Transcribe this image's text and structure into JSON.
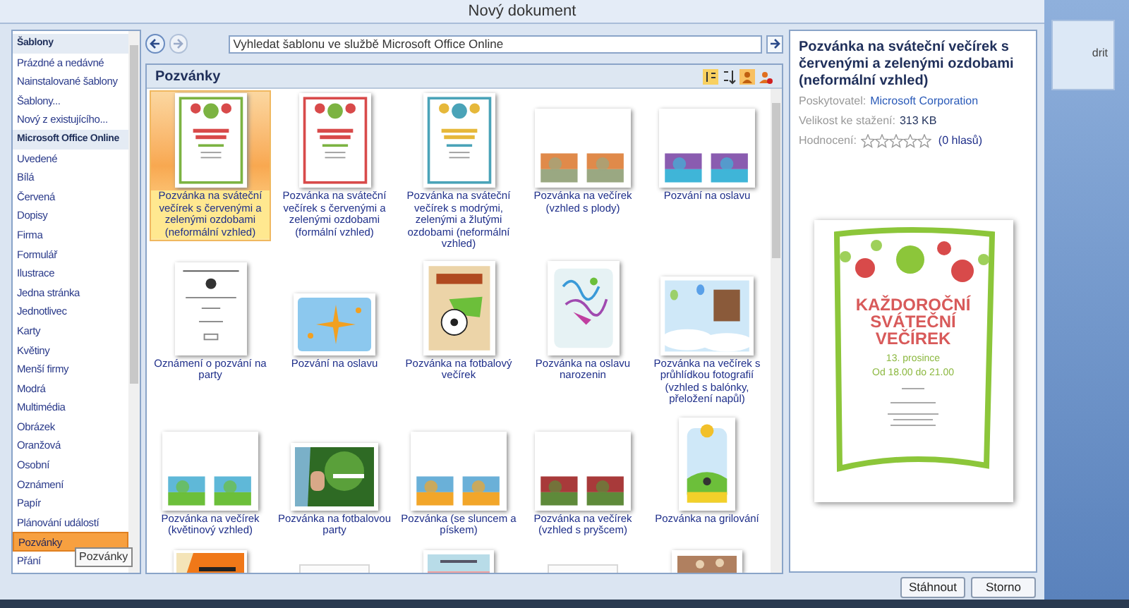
{
  "window": {
    "title": "Nový dokument"
  },
  "sidebar": {
    "items": [
      {
        "label": "Šablony",
        "kind": "header",
        "selected": false
      },
      {
        "label": "Prázdné a nedávné",
        "kind": "item",
        "selected": false
      },
      {
        "label": "Nainstalované šablony",
        "kind": "item",
        "selected": false
      },
      {
        "label": "Šablony...",
        "kind": "item",
        "selected": false
      },
      {
        "label": "Nový z existujícího...",
        "kind": "item",
        "selected": false
      },
      {
        "label": "Microsoft Office Online",
        "kind": "header",
        "selected": false
      },
      {
        "label": "Uvedené",
        "kind": "item",
        "selected": false
      },
      {
        "label": "Bílá",
        "kind": "item",
        "selected": false
      },
      {
        "label": "Červená",
        "kind": "item",
        "selected": false
      },
      {
        "label": "Dopisy",
        "kind": "item",
        "selected": false
      },
      {
        "label": "Firma",
        "kind": "item",
        "selected": false
      },
      {
        "label": "Formulář",
        "kind": "item",
        "selected": false
      },
      {
        "label": "Ilustrace",
        "kind": "item",
        "selected": false
      },
      {
        "label": "Jedna stránka",
        "kind": "item",
        "selected": false
      },
      {
        "label": "Jednotlivec",
        "kind": "item",
        "selected": false
      },
      {
        "label": "Karty",
        "kind": "item",
        "selected": false
      },
      {
        "label": "Květiny",
        "kind": "item",
        "selected": false
      },
      {
        "label": "Menší firmy",
        "kind": "item",
        "selected": false
      },
      {
        "label": "Modrá",
        "kind": "item",
        "selected": false
      },
      {
        "label": "Multimédia",
        "kind": "item",
        "selected": false
      },
      {
        "label": "Obrázek",
        "kind": "item",
        "selected": false
      },
      {
        "label": "Oranžová",
        "kind": "item",
        "selected": false
      },
      {
        "label": "Osobní",
        "kind": "item",
        "selected": false
      },
      {
        "label": "Oznámení",
        "kind": "item",
        "selected": false
      },
      {
        "label": "Papír",
        "kind": "item",
        "selected": false
      },
      {
        "label": "Plánování událostí",
        "kind": "item",
        "selected": false
      },
      {
        "label": "Pozvánky",
        "kind": "item",
        "selected": true
      },
      {
        "label": "Přání",
        "kind": "item",
        "selected": false
      }
    ],
    "tooltip": "Pozvánky"
  },
  "search": {
    "placeholder": "Vyhledat šablonu ve službě Microsoft Office Online"
  },
  "gallery": {
    "title": "Pozvánky",
    "templates": [
      {
        "label": "Pozvánka na sváteční večírek s červenými a zelenými ozdobami (neformální vzhled)",
        "kind": "ornament-green",
        "selected": true
      },
      {
        "label": "Pozvánka na sváteční večírek s červenými a zelenými ozdobami (formální vzhled)",
        "kind": "ornament-red",
        "selected": false
      },
      {
        "label": "Pozvánka na sváteční večírek s modrými, zelenými a žlutými ozdobami (neformální vzhled)",
        "kind": "ornament-blue",
        "selected": false
      },
      {
        "label": "Pozvánka na večírek (vzhled s plody)",
        "kind": "pair-orange",
        "selected": false
      },
      {
        "label": "Pozvání na oslavu",
        "kind": "pair-purple",
        "selected": false
      },
      {
        "label": "Oznámení o pozvání na party",
        "kind": "document",
        "selected": false
      },
      {
        "label": "Pozvání na oslavu",
        "kind": "stars",
        "selected": false
      },
      {
        "label": "Pozvánka na fotbalový večírek",
        "kind": "football",
        "selected": false
      },
      {
        "label": "Pozvánka na oslavu narozenin",
        "kind": "streamers",
        "selected": false
      },
      {
        "label": "Pozvánka na večírek s průhlídkou fotografií (vzhled s balónky, přeložení napůl)",
        "kind": "balloons",
        "selected": false
      },
      {
        "label": "Pozvánka na večírek (květinový vzhled)",
        "kind": "pair-grass",
        "selected": false
      },
      {
        "label": "Pozvánka na fotbalovou party",
        "kind": "green-card",
        "selected": false
      },
      {
        "label": "Pozvánka (se sluncem a pískem)",
        "kind": "pair-sun",
        "selected": false
      },
      {
        "label": "Pozvánka na večírek (vzhled s pryšcem)",
        "kind": "pair-flowers",
        "selected": false
      },
      {
        "label": "Pozvánka na grilování",
        "kind": "tall-sun",
        "selected": false
      },
      {
        "kind": "halloween",
        "selected": false
      },
      {
        "kind": "blank",
        "selected": false
      },
      {
        "kind": "card",
        "selected": false
      },
      {
        "kind": "blank",
        "selected": false
      },
      {
        "kind": "photo-brown",
        "selected": false
      }
    ]
  },
  "details": {
    "title": "Pozvánka na sváteční večírek s červenými a zelenými ozdobami (neformální vzhled)",
    "fields": [
      {
        "label": "Poskytovatel:",
        "value": "Microsoft Corporation",
        "kind": "link"
      },
      {
        "label": "Velikost ke stažení:",
        "value": "313 KB",
        "kind": "text"
      }
    ],
    "rating": {
      "label": "Hodnocení:",
      "stars": 0,
      "votes": "(0 hlasů)"
    },
    "preview": {
      "heading": [
        "KAŽDOROČNÍ",
        "SVÁTEČNÍ",
        "VEČÍREK"
      ],
      "date": "13. prosince",
      "time": "Od 18.00 do 21.00"
    }
  },
  "buttons": [
    "Stáhnout",
    "Storno"
  ],
  "background": {
    "ribbon_text": "drit"
  }
}
